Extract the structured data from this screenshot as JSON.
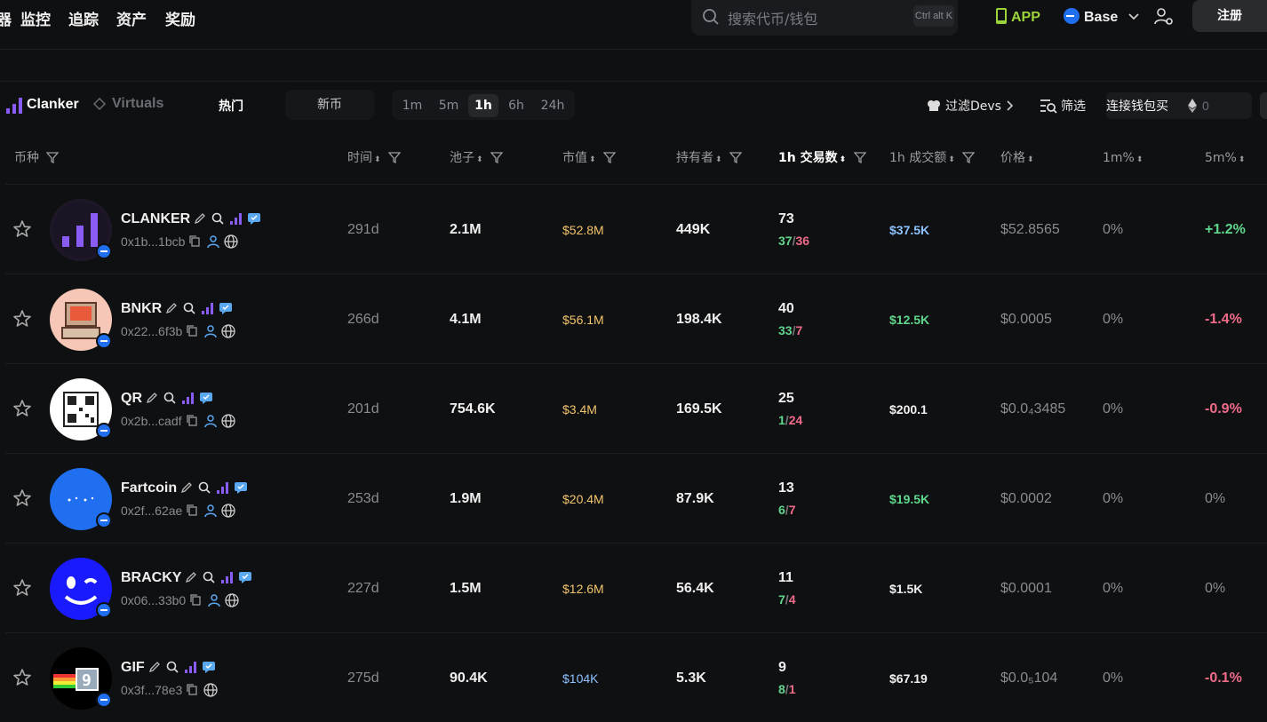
{
  "nav": {
    "partial": "器",
    "items": [
      "监控",
      "追踪",
      "资产",
      "奖励"
    ]
  },
  "search": {
    "placeholder": "搜索代币/钱包",
    "shortcut": "Ctrl alt K"
  },
  "header": {
    "app_label": "APP",
    "chain_label": "Base",
    "register_label": "注册"
  },
  "platforms": {
    "clanker": "Clanker",
    "virtuals": "Virtuals"
  },
  "tabs": {
    "hot": "热门",
    "new": "新币"
  },
  "timeframes": [
    "1m",
    "5m",
    "1h",
    "6h",
    "24h"
  ],
  "active_timeframe": "1h",
  "filters": {
    "filter_devs": "过滤Devs",
    "screen": "筛选",
    "connect_buy": "连接钱包买",
    "amount": "0"
  },
  "columns": {
    "coin": "币种",
    "time": "时间",
    "pool": "池子",
    "mcap": "市值",
    "holders": "持有者",
    "tx1h": "1h 交易数",
    "vol1h": "1h 成交额",
    "price": "价格",
    "m1": "1m%",
    "m5": "5m%"
  },
  "colors": {
    "accent_purple": "#8a5cf6",
    "green": "#5fd68b",
    "red": "#f06b8a",
    "gold": "#f3c46b",
    "blue": "#1f6ff0"
  },
  "rows": [
    {
      "name": "CLANKER",
      "addr": "0x1b...1bcb",
      "age": "291d",
      "pool": "2.1M",
      "mcap": "$52.8M",
      "holders": "449K",
      "tx": "73",
      "buys": "37",
      "sells": "36",
      "vol": "$37.5K",
      "price": "$52.8565",
      "m1": "0%",
      "m5": "+1.2%"
    },
    {
      "name": "BNKR",
      "addr": "0x22...6f3b",
      "age": "266d",
      "pool": "4.1M",
      "mcap": "$56.1M",
      "holders": "198.4K",
      "tx": "40",
      "buys": "33",
      "sells": "7",
      "vol": "$12.5K",
      "price": "$0.0005",
      "m1": "0%",
      "m5": "-1.4%"
    },
    {
      "name": "QR",
      "addr": "0x2b...cadf",
      "age": "201d",
      "pool": "754.6K",
      "mcap": "$3.4M",
      "holders": "169.5K",
      "tx": "25",
      "buys": "1",
      "sells": "24",
      "vol": "$200.1",
      "price": "$0.0₄3485",
      "m1": "0%",
      "m5": "-0.9%"
    },
    {
      "name": "Fartcoin",
      "addr": "0x2f...62ae",
      "age": "253d",
      "pool": "1.9M",
      "mcap": "$20.4M",
      "holders": "87.9K",
      "tx": "13",
      "buys": "6",
      "sells": "7",
      "vol": "$19.5K",
      "price": "$0.0002",
      "m1": "0%",
      "m5": "0%"
    },
    {
      "name": "BRACKY",
      "addr": "0x06...33b0",
      "age": "227d",
      "pool": "1.5M",
      "mcap": "$12.6M",
      "holders": "56.4K",
      "tx": "11",
      "buys": "7",
      "sells": "4",
      "vol": "$1.5K",
      "price": "$0.0001",
      "m1": "0%",
      "m5": "0%"
    },
    {
      "name": "GIF",
      "addr": "0x3f...78e3",
      "age": "275d",
      "pool": "90.4K",
      "mcap": "$104K",
      "holders": "5.3K",
      "tx": "9",
      "buys": "8",
      "sells": "1",
      "vol": "$67.19",
      "price": "$0.0₅104",
      "m1": "0%",
      "m5": "-0.1%"
    }
  ]
}
